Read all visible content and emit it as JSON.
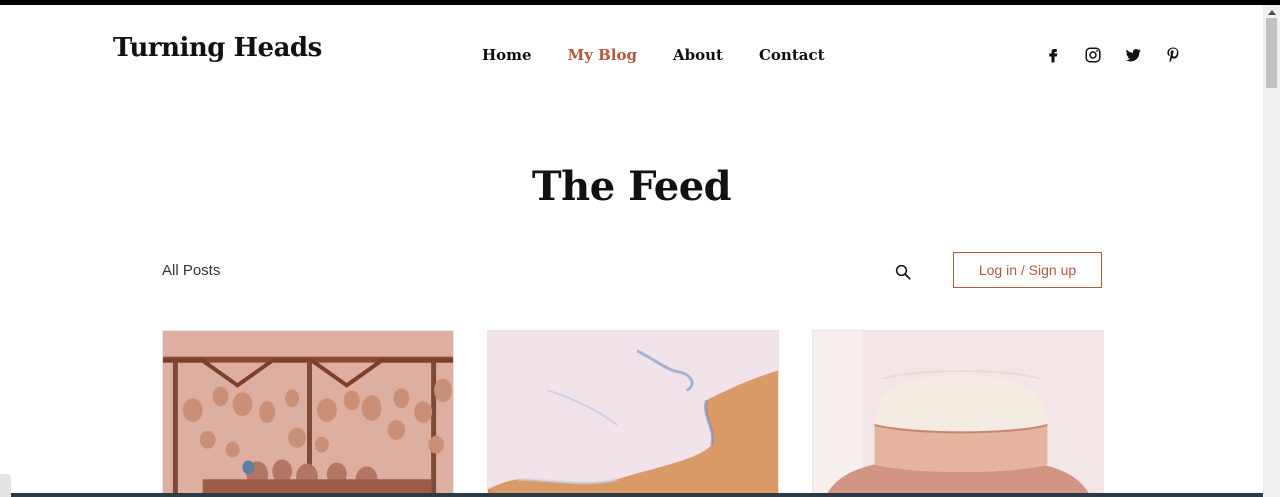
{
  "header": {
    "site_title": "Turning Heads",
    "nav": [
      {
        "label": "Home",
        "active": false
      },
      {
        "label": "My Blog",
        "active": true
      },
      {
        "label": "About",
        "active": false
      },
      {
        "label": "Contact",
        "active": false
      }
    ],
    "social_icons": [
      "facebook-icon",
      "instagram-icon",
      "twitter-icon",
      "pinterest-icon"
    ]
  },
  "feed": {
    "title": "The Feed",
    "all_posts_label": "All Posts",
    "login_label": "Log in / Sign up"
  },
  "colors": {
    "accent": "#b5563f",
    "text": "#111111"
  },
  "cards": [
    {
      "image": "clay-pots-hanging"
    },
    {
      "image": "beach-wave-sand"
    },
    {
      "image": "straw-hat"
    }
  ]
}
